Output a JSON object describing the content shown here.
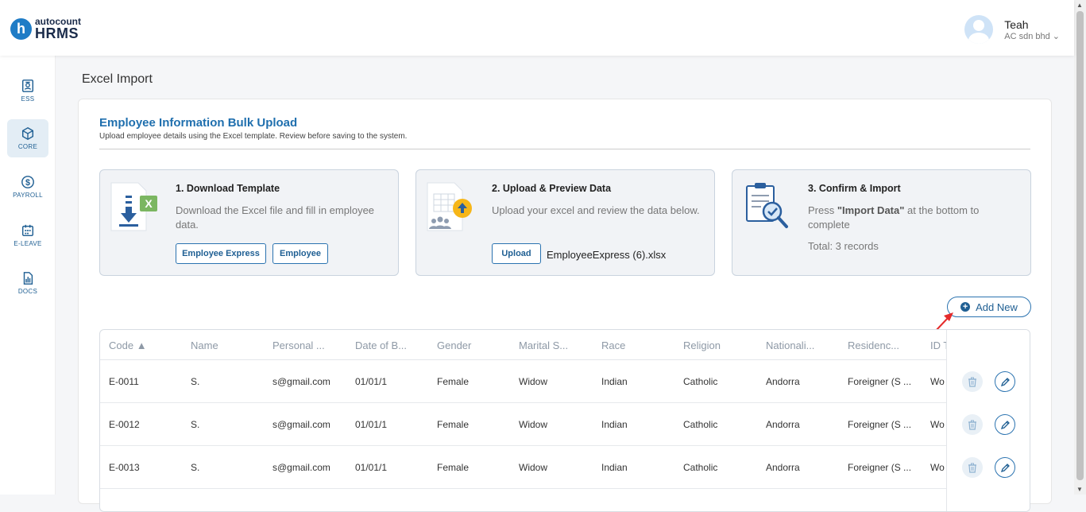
{
  "brand": {
    "logo_letter": "h",
    "name_small": "autocount",
    "name_big": "HRMS"
  },
  "user": {
    "name": "Teah",
    "company": "AC sdn bhd",
    "chevron": "⌄"
  },
  "sidebar": {
    "items": [
      {
        "label": "ESS",
        "icon": "id-card-icon"
      },
      {
        "label": "CORE",
        "icon": "cube-icon"
      },
      {
        "label": "PAYROLL",
        "icon": "dollar-icon"
      },
      {
        "label": "E-LEAVE",
        "icon": "calendar-icon"
      },
      {
        "label": "DOCS",
        "icon": "document-icon"
      }
    ]
  },
  "page": {
    "title": "Excel Import"
  },
  "card": {
    "title": "Employee Information Bulk Upload",
    "subtitle": "Upload employee details using the Excel template. Review before saving to the system."
  },
  "steps": {
    "download": {
      "title": "1. Download Template",
      "desc": "Download the Excel file and fill in employee data.",
      "btn_express": "Employee Express",
      "btn_employee": "Employee"
    },
    "upload": {
      "title": "2. Upload & Preview Data",
      "desc": "Upload your excel and review the data below.",
      "btn_upload": "Upload",
      "file_name": "EmployeeExpress (6).xlsx"
    },
    "confirm": {
      "title": "3. Confirm & Import",
      "desc_pre": "Press ",
      "desc_bold": "\"Import Data\"",
      "desc_post": " at the bottom to complete",
      "total": "Total: 3 records"
    }
  },
  "add_new_label": "Add New",
  "table": {
    "headers": [
      "Code ▲",
      "Name",
      "Personal ...",
      "Date of B...",
      "Gender",
      "Marital S...",
      "Race",
      "Religion",
      "Nationali...",
      "Residenc...",
      "ID T"
    ],
    "rows": [
      [
        "E-0011",
        "S.",
        "s@gmail.com",
        "01/01/1",
        "Female",
        "Widow",
        "Indian",
        "Catholic",
        "Andorra",
        "Foreigner (S ...",
        "Wo"
      ],
      [
        "E-0012",
        "S.",
        "s@gmail.com",
        "01/01/1",
        "Female",
        "Widow",
        "Indian",
        "Catholic",
        "Andorra",
        "Foreigner (S ...",
        "Wo"
      ],
      [
        "E-0013",
        "S.",
        "s@gmail.com",
        "01/01/1",
        "Female",
        "Widow",
        "Indian",
        "Catholic",
        "Andorra",
        "Foreigner (S ...",
        "Wo"
      ]
    ]
  },
  "colors": {
    "brand_blue": "#1f7cc6",
    "accent": "#2b73b0",
    "title_blue": "#1f6fae",
    "annotation_arrow": "#e52b2b"
  }
}
